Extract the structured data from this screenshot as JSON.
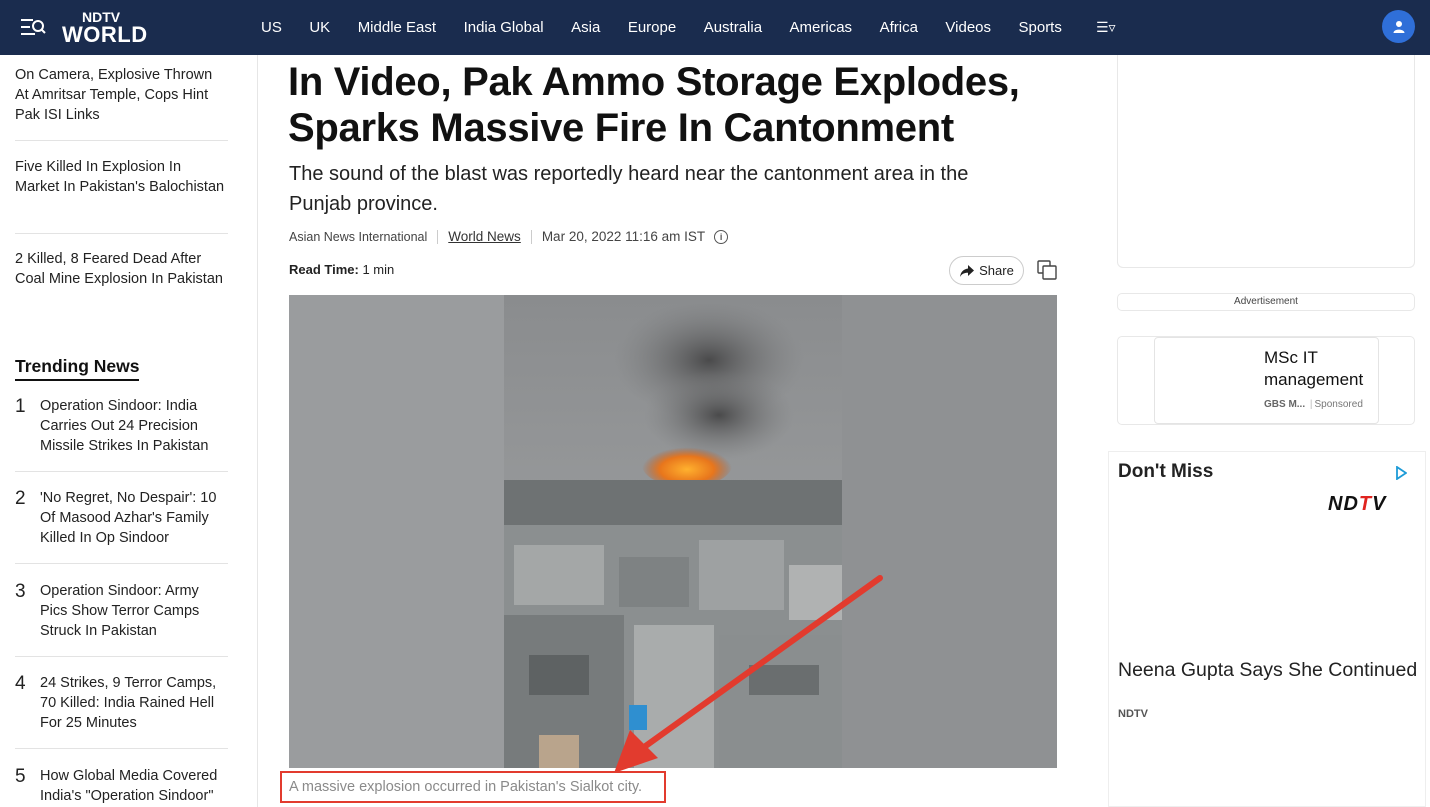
{
  "nav": {
    "logo_top": "NDTV",
    "logo_bottom": "WORLD",
    "links": [
      "US",
      "UK",
      "Middle East",
      "India Global",
      "Asia",
      "Europe",
      "Australia",
      "Americas",
      "Africa",
      "Videos",
      "Sports"
    ],
    "more_symbol": "☰▿"
  },
  "related": [
    "On Camera, Explosive Thrown At Amritsar Temple, Cops Hint Pak ISI Links",
    "Five Killed In Explosion In Market In Pakistan's Balochistan",
    "2 Killed, 8 Feared Dead After Coal Mine Explosion In Pakistan"
  ],
  "trending": {
    "title": "Trending News",
    "items": [
      {
        "num": "1",
        "text": "Operation Sindoor: India Carries Out 24 Precision Missile Strikes In Pakistan"
      },
      {
        "num": "2",
        "text": "'No Regret, No Despair': 10 Of Masood Azhar's Family Killed In Op Sindoor"
      },
      {
        "num": "3",
        "text": "Operation Sindoor: Army Pics Show Terror Camps Struck In Pakistan"
      },
      {
        "num": "4",
        "text": "24 Strikes, 9 Terror Camps, 70 Killed: India Rained Hell For 25 Minutes"
      },
      {
        "num": "5",
        "text": "How Global Media Covered India's \"Operation Sindoor\""
      }
    ]
  },
  "article": {
    "title": "In Video, Pak Ammo Storage Explodes, Sparks Massive Fire In Cantonment",
    "subtitle": "The sound of the blast was reportedly heard near the cantonment area in the Punjab province.",
    "source": "Asian News International",
    "category": "World News",
    "date": "Mar 20, 2022 11:16 am IST",
    "read_time_label": "Read Time:",
    "read_time_value": "1 min",
    "share_label": "Share",
    "caption": "A massive explosion occurred in Pakistan's Sialkot city."
  },
  "ads": {
    "label": "Advertisement",
    "headline": "MSc IT management",
    "source": "GBS M...",
    "sponsored": "Sponsored"
  },
  "dont_miss": {
    "title": "Don't Miss",
    "logo_pre": "ND",
    "logo_red": "T",
    "logo_post": "V",
    "headline": "Neena Gupta Says She Continued Her Affair With Vivian Richards For",
    "source": "NDTV"
  },
  "colors": {
    "nav_bg": "#1a2c4e",
    "avatar": "#2f6fd8",
    "annotation_red": "#e23b2e"
  }
}
